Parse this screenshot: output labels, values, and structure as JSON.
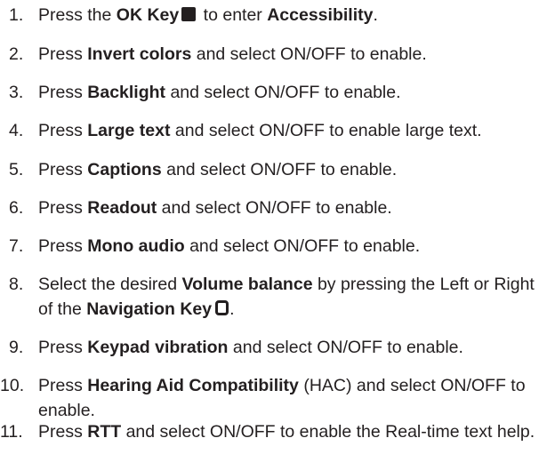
{
  "steps": [
    {
      "num": "1.",
      "t1": "Press the ",
      "b1": "OK Key",
      "t2": " to enter ",
      "b2": "Accessibility",
      "t3": ".",
      "icon": "ok-key-icon"
    },
    {
      "num": "2.",
      "t1": "Press ",
      "b1": "Invert colors",
      "t2": " and select ON/OFF to enable."
    },
    {
      "num": "3.",
      "t1": "Press ",
      "b1": "Backlight",
      "t2": " and select ON/OFF to enable."
    },
    {
      "num": "4.",
      "t1": "Press ",
      "b1": "Large text",
      "t2": " and select ON/OFF to enable large text."
    },
    {
      "num": "5.",
      "t1": "Press ",
      "b1": "Captions",
      "t2": " and select ON/OFF to enable."
    },
    {
      "num": "6.",
      "t1": "Press ",
      "b1": "Readout",
      "t2": " and select ON/OFF to enable."
    },
    {
      "num": "7.",
      "t1": "Press ",
      "b1": "Mono audio",
      "t2": " and select ON/OFF to enable."
    },
    {
      "num": "8.",
      "t1": "Select the desired ",
      "b1": "Volume balance",
      "t2": " by pressing the Left or Right of the ",
      "b2": "Navigation Key",
      "t3": ".",
      "icon": "navigation-key-icon"
    },
    {
      "num": "9.",
      "t1": "Press ",
      "b1": "Keypad vibration",
      "t2": " and select ON/OFF to enable."
    },
    {
      "num": "10.",
      "t1": "Press ",
      "b1": "Hearing Aid Compatibility",
      "t2": " (HAC) and select ON/OFF to enable."
    },
    {
      "num": "11.",
      "t1": "Press ",
      "b1": "RTT",
      "t2": " and select ON/OFF to enable the Real-time text help."
    }
  ],
  "colors": {
    "text": "#231f20",
    "background": "#ffffff"
  }
}
